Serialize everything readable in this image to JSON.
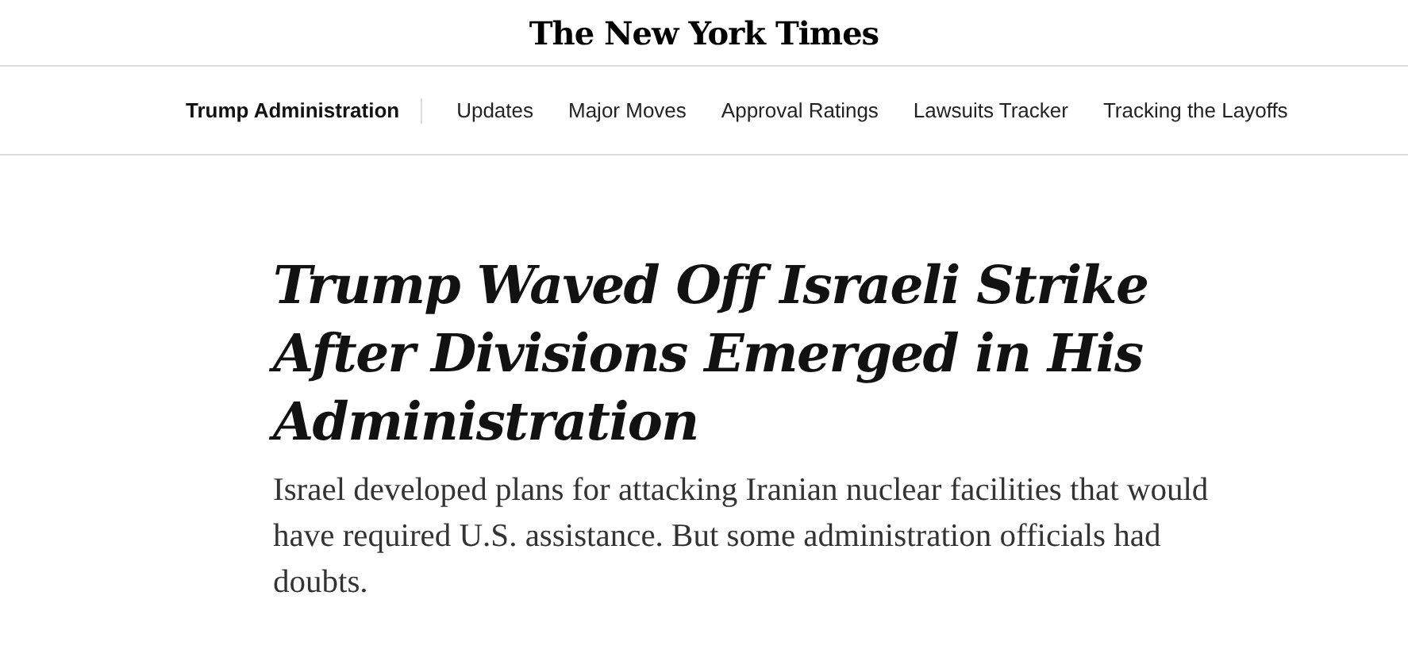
{
  "masthead": {
    "logo": "The New York Times"
  },
  "section_nav": {
    "section": "Trump Administration",
    "links": [
      "Updates",
      "Major Moves",
      "Approval Ratings",
      "Lawsuits Tracker",
      "Tracking the Layoffs"
    ]
  },
  "article": {
    "headline": "Trump Waved Off Israeli Strike After Divisions Emerged in His Administration",
    "summary": "Israel developed plans for attacking Iranian nuclear facilities that would have required U.S. assistance. But some administration officials had doubts."
  }
}
